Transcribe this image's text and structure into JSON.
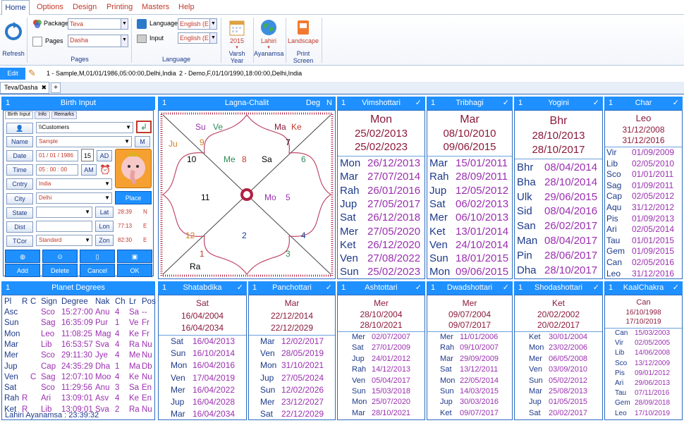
{
  "menu": [
    "Home",
    "Options",
    "Design",
    "Printing",
    "Masters",
    "Help"
  ],
  "ribbon": {
    "refresh_label": "Refresh",
    "package_label": "Package",
    "package_value": "Teva",
    "pages_label": "Pages",
    "pages_value": "Dasha",
    "pages_group": "Pages",
    "language_label": "Language",
    "language_value": "English (E",
    "input_label": "Input",
    "input_value": "English (E",
    "language_group": "Language",
    "varsh_year_value": "2015",
    "varsh_year_label": "Varsh Year",
    "ayanamsa_value": "Lahiri",
    "ayanamsa_label": "Ayanamsa",
    "print_value": "Landscape",
    "print_label": "Print Screen"
  },
  "editbar": {
    "edit_dob": "Edit DOB",
    "record1": "1 - Sample,M,01/01/1986,05:00:00,Delhi,India",
    "record2": "2 - Demo,F,01/10/1990,18:00:00,Delhi,India"
  },
  "doc_tab": "Teva/Dasha",
  "birth_input": {
    "header": "Birth Input",
    "tabs": [
      "Birth Input",
      "Info",
      "Remarks"
    ],
    "customers": "\\\\Customers",
    "name_label": "Name",
    "name_value": "Sample",
    "name_btn": "M",
    "date_label": "Date",
    "date_value": "01 / 01 / 1986",
    "date_day": "15",
    "date_ad": "AD",
    "time_label": "Time",
    "time_value": "05 : 00 : 00",
    "time_am": "AM",
    "cntry_label": "Cntry",
    "cntry_value": "India",
    "city_label": "City",
    "city_value": "Delhi",
    "place_finder": "Place Finder",
    "state_label": "State",
    "lat_label": "Lat",
    "lat_value": "28:39",
    "lat_dir": "N",
    "dist_label": "Dist",
    "lon_label": "Lon",
    "lon_value": "77:13",
    "lon_dir": "E",
    "tcor_label": "TCor",
    "tcor_value": "Standard",
    "zon_label": "Zon",
    "zon_value": "82:30",
    "zon_dir": "E",
    "buttons": [
      "Add",
      "Delete",
      "Cancel",
      "OK"
    ]
  },
  "lagna": {
    "header_num": "1",
    "header": "Lagna-Chalit",
    "header_deg": "Deg",
    "header_n": "N",
    "houses": [
      "9",
      "10",
      "Me",
      "8",
      "Sa",
      "7",
      "6",
      "11",
      "Mo",
      "5",
      "12",
      "2",
      "4",
      "1",
      "3"
    ],
    "planets_top": [
      "Su",
      "Ve",
      "Ma",
      "Ke"
    ],
    "planet_ju": "Ju",
    "planet_ra": "Ra"
  },
  "vimshottari": {
    "num": "1",
    "title": "Vimshottari",
    "main": "Mon",
    "d1": "25/02/2013",
    "d2": "25/02/2023",
    "rows": [
      [
        "Mon",
        "26/12/2013"
      ],
      [
        "Mar",
        "27/07/2014"
      ],
      [
        "Rah",
        "26/01/2016"
      ],
      [
        "Jup",
        "27/05/2017"
      ],
      [
        "Sat",
        "26/12/2018"
      ],
      [
        "Mer",
        "27/05/2020"
      ],
      [
        "Ket",
        "26/12/2020"
      ],
      [
        "Ven",
        "27/08/2022"
      ],
      [
        "Sun",
        "25/02/2023"
      ]
    ]
  },
  "tribhagi": {
    "num": "1",
    "title": "Tribhagi",
    "main": "Mar",
    "d1": "08/10/2010",
    "d2": "09/06/2015",
    "rows": [
      [
        "Mar",
        "15/01/2011"
      ],
      [
        "Rah",
        "28/09/2011"
      ],
      [
        "Jup",
        "12/05/2012"
      ],
      [
        "Sat",
        "06/02/2013"
      ],
      [
        "Mer",
        "06/10/2013"
      ],
      [
        "Ket",
        "13/01/2014"
      ],
      [
        "Ven",
        "24/10/2014"
      ],
      [
        "Sun",
        "18/01/2015"
      ],
      [
        "Mon",
        "09/06/2015"
      ]
    ]
  },
  "yogini": {
    "num": "1",
    "title": "Yogini",
    "main": "Bhr",
    "d1": "28/10/2013",
    "d2": "28/10/2017",
    "rows": [
      [
        "Bhr",
        "08/04/2014"
      ],
      [
        "Bha",
        "28/10/2014"
      ],
      [
        "Ulk",
        "29/06/2015"
      ],
      [
        "Sid",
        "08/04/2016"
      ],
      [
        "San",
        "26/02/2017"
      ],
      [
        "Man",
        "08/04/2017"
      ],
      [
        "Pin",
        "28/06/2017"
      ],
      [
        "Dha",
        "28/10/2017"
      ]
    ]
  },
  "char": {
    "num": "1",
    "title": "Char",
    "main": "Leo",
    "d1": "31/12/2008",
    "d2": "31/12/2016",
    "rows": [
      [
        "Vir",
        "01/09/2009"
      ],
      [
        "Lib",
        "02/05/2010"
      ],
      [
        "Sco",
        "01/01/2011"
      ],
      [
        "Sag",
        "01/09/2011"
      ],
      [
        "Cap",
        "02/05/2012"
      ],
      [
        "Aqu",
        "31/12/2012"
      ],
      [
        "Pis",
        "01/09/2013"
      ],
      [
        "Ari",
        "02/05/2014"
      ],
      [
        "Tau",
        "01/01/2015"
      ],
      [
        "Gem",
        "01/09/2015"
      ],
      [
        "Can",
        "02/05/2016"
      ],
      [
        "Leo",
        "31/12/2016"
      ]
    ]
  },
  "planet_degrees": {
    "num": "1",
    "title": "Planet Degrees",
    "cols": [
      "Pl",
      "R",
      "C",
      "Sign",
      "Degree",
      "Nak",
      "Ch",
      "Lr",
      "Pos"
    ],
    "rows": [
      [
        "Asc",
        "",
        "",
        "Sco",
        "15:27:00",
        "Anu",
        "4",
        "Sa",
        "--"
      ],
      [
        "Sun",
        "",
        "",
        "Sag",
        "16:35:09",
        "Pur",
        "1",
        "Ve",
        "Fr"
      ],
      [
        "Mon",
        "",
        "",
        "Leo",
        "11:08:25",
        "Mag",
        "4",
        "Ke",
        "Fr"
      ],
      [
        "Mar",
        "",
        "",
        "Lib",
        "16:53:57",
        "Sva",
        "4",
        "Ra",
        "Nu"
      ],
      [
        "Mer",
        "",
        "",
        "Sco",
        "29:11:30",
        "Jye",
        "4",
        "Me",
        "Nu"
      ],
      [
        "Jup",
        "",
        "",
        "Cap",
        "24:35:29",
        "Dha",
        "1",
        "Ma",
        "Db"
      ],
      [
        "Ven",
        "",
        "C",
        "Sag",
        "12:07:10",
        "Moo",
        "4",
        "Ke",
        "Nu"
      ],
      [
        "Sat",
        "",
        "",
        "Sco",
        "11:29:56",
        "Anu",
        "3",
        "Sa",
        "En"
      ],
      [
        "Rah",
        "R",
        "",
        "Ari",
        "13:09:01",
        "Asv",
        "4",
        "Ke",
        "En"
      ],
      [
        "Ket",
        "R",
        "",
        "Lib",
        "13:09:01",
        "Sva",
        "2",
        "Ra",
        "Nu"
      ]
    ],
    "footer": "Lahiri Ayanamsa : 23:39:32"
  },
  "shatabdika": {
    "num": "1",
    "title": "Shatabdika",
    "main": "Sat",
    "d1": "16/04/2004",
    "d2": "16/04/2034",
    "rows": [
      [
        "Sat",
        "16/04/2013"
      ],
      [
        "Sun",
        "16/10/2014"
      ],
      [
        "Mon",
        "16/04/2016"
      ],
      [
        "Ven",
        "17/04/2019"
      ],
      [
        "Mer",
        "16/04/2022"
      ],
      [
        "Jup",
        "16/04/2028"
      ],
      [
        "Mar",
        "16/04/2034"
      ]
    ]
  },
  "panchottari": {
    "num": "1",
    "title": "Panchottari",
    "main": "Mar",
    "d1": "22/12/2014",
    "d2": "22/12/2029",
    "rows": [
      [
        "Mar",
        "12/02/2017"
      ],
      [
        "Ven",
        "28/05/2019"
      ],
      [
        "Mon",
        "31/10/2021"
      ],
      [
        "Jup",
        "27/05/2024"
      ],
      [
        "Sun",
        "12/02/2026"
      ],
      [
        "Mer",
        "23/12/2027"
      ],
      [
        "Sat",
        "22/12/2029"
      ]
    ]
  },
  "ashtottari": {
    "num": "1",
    "title": "Ashtottari",
    "main": "Mer",
    "d1": "28/10/2004",
    "d2": "28/10/2021",
    "rows": [
      [
        "Mer",
        "02/07/2007"
      ],
      [
        "Sat",
        "27/01/2009"
      ],
      [
        "Jup",
        "24/01/2012"
      ],
      [
        "Rah",
        "14/12/2013"
      ],
      [
        "Ven",
        "05/04/2017"
      ],
      [
        "Sun",
        "15/03/2018"
      ],
      [
        "Mon",
        "25/07/2020"
      ],
      [
        "Mar",
        "28/10/2021"
      ]
    ]
  },
  "dwadshottari": {
    "num": "1",
    "title": "Dwadshottari",
    "main": "Mer",
    "d1": "09/07/2004",
    "d2": "09/07/2017",
    "rows": [
      [
        "Mer",
        "11/01/2006"
      ],
      [
        "Rah",
        "09/10/2007"
      ],
      [
        "Mar",
        "29/09/2009"
      ],
      [
        "Sat",
        "13/12/2011"
      ],
      [
        "Mon",
        "22/05/2014"
      ],
      [
        "Sun",
        "14/03/2015"
      ],
      [
        "Jup",
        "30/03/2016"
      ],
      [
        "Ket",
        "09/07/2017"
      ]
    ]
  },
  "shodashottari": {
    "num": "1",
    "title": "Shodashottari",
    "main": "Ket",
    "d1": "20/02/2002",
    "d2": "20/02/2017",
    "rows": [
      [
        "Ket",
        "30/01/2004"
      ],
      [
        "Mon",
        "23/02/2006"
      ],
      [
        "Mer",
        "06/05/2008"
      ],
      [
        "Ven",
        "03/09/2010"
      ],
      [
        "Sun",
        "05/02/2012"
      ],
      [
        "Mar",
        "25/08/2013"
      ],
      [
        "Jup",
        "01/05/2015"
      ],
      [
        "Sat",
        "20/02/2017"
      ]
    ]
  },
  "kaalchakra": {
    "num": "1",
    "title": "KaalChakra",
    "main": "Can",
    "d1": "16/10/1998",
    "d2": "17/10/2019",
    "rows": [
      [
        "Can",
        "15/03/2003"
      ],
      [
        "Vir",
        "02/05/2005"
      ],
      [
        "Lib",
        "14/06/2008"
      ],
      [
        "Sco",
        "13/12/2009"
      ],
      [
        "Pis",
        "09/01/2012"
      ],
      [
        "Ari",
        "29/06/2013"
      ],
      [
        "Tau",
        "07/11/2016"
      ],
      [
        "Gem",
        "28/09/2018"
      ],
      [
        "Leo",
        "17/10/2019"
      ]
    ]
  },
  "check_mark": "✓"
}
